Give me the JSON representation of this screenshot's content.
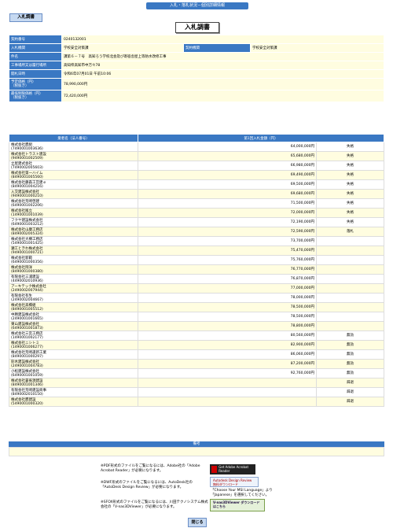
{
  "header": {
    "top_title": "入札・落札状況－個別詳細情報",
    "tag": "入札調書",
    "page_title": "入札調書"
  },
  "info": [
    {
      "label": "契約番号",
      "value": "0240132001"
    },
    {
      "label": "入札機関",
      "value": "学校安全対策課",
      "label2": "契約機関",
      "value2": "学校安全対策課"
    },
    {
      "label": "件名",
      "value": "課第６－７号　高知ろう学校北会及び寄宿舎屋上等防水改修工事"
    },
    {
      "label": "工事場所又は履行場所",
      "value": "高知県高知市中万々78"
    },
    {
      "label": "開札日時",
      "value": "令和6年07月01日 午前10:06"
    },
    {
      "label": "予定価格（円）\n（税抜き）",
      "value": "78,990,000円"
    },
    {
      "label": "最低制限価格（円）\n（税抜き）",
      "value": "72,420,000円"
    }
  ],
  "bids_header": {
    "name": "業者名（法人番号）",
    "amount": "第1回入札金額（円）"
  },
  "bids": [
    {
      "name": "株式会社鷹組",
      "id": "(7490001003636)",
      "amount": "64,000,000円",
      "result": "失格"
    },
    {
      "name": "株式会社トラスト建設",
      "id": "(9490001002509)",
      "amount": "65,680,000円",
      "result": "失格"
    },
    {
      "name": "立屋建式会社",
      "id": "(7490002005603)",
      "amount": "66,980,000円",
      "result": "失格"
    },
    {
      "name": "株式会社第一ハイム",
      "id": "(8490001005560)",
      "amount": "69,490,000円",
      "result": "失格"
    },
    {
      "name": "株式会社藤森工営建ｅ",
      "id": "(8490001004216)",
      "amount": "69,500,000円",
      "result": "失格"
    },
    {
      "name": "入交建設株式会社",
      "id": "(9490001000210)",
      "amount": "69,680,000円",
      "result": "失格"
    },
    {
      "name": "株式会社荒崎啓建",
      "id": "(6490001002206)",
      "amount": "71,500,000円",
      "result": "失格"
    },
    {
      "name": "株式会社尾立",
      "id": "(1490001001039)",
      "amount": "72,000,000円",
      "result": "失格"
    },
    {
      "name": "フクヤ建設株式会社",
      "id": "(6490001003212)",
      "amount": "72,190,000円",
      "result": "失格"
    },
    {
      "name": "株式会社山康工務店",
      "id": "(8490002005324)",
      "amount": "72,590,000円",
      "result": "落札"
    },
    {
      "name": "株式会社大樽工務店",
      "id": "(5490001001425)",
      "amount": "73,700,000円",
      "result": ""
    },
    {
      "name": "瀬工ときわ株式会社",
      "id": "(9490001000721)",
      "amount": "75,470,000円",
      "result": ""
    },
    {
      "name": "株式会社新範",
      "id": "(6490001000356)",
      "amount": "75,760,000円",
      "result": ""
    },
    {
      "name": "株式会社岡洋",
      "id": "(8490001000380)",
      "amount": "76,770,000円",
      "result": ""
    },
    {
      "name": "有限会社三浦建設",
      "id": "(4490002010936)",
      "amount": "76,870,000円",
      "result": ""
    },
    {
      "name": "アーキテック株式会社",
      "id": "(2490002007944)",
      "amount": "77,000,000円",
      "result": ""
    },
    {
      "name": "有限会社有生",
      "id": "(2490002004667)",
      "amount": "78,000,000円",
      "result": ""
    },
    {
      "name": "株式会社高橋組",
      "id": "(8490001005512)",
      "amount": "78,500,000円",
      "result": ""
    },
    {
      "name": "中勝建設株式会社",
      "id": "(2490001001665)",
      "amount": "78,500,000円",
      "result": ""
    },
    {
      "name": "東山建設株式会社",
      "id": "(6490001001873)",
      "amount": "78,800,000円",
      "result": ""
    },
    {
      "name": "株式会社三宮工務店",
      "id": "(1490001002177)",
      "amount": "80,560,000円",
      "result": "無効"
    },
    {
      "name": "株式会社ニシトミ",
      "id": "(1490001006277)",
      "amount": "82,900,000円",
      "result": "無効"
    },
    {
      "name": "株式会社荒崎逢新工業",
      "id": "(8490001000297)",
      "amount": "86,060,000円",
      "result": "無効"
    },
    {
      "name": "鈴木建設株式会社",
      "id": "(2490001004783)",
      "amount": "87,200,000円",
      "result": "無効"
    },
    {
      "name": "小松建設株式会社",
      "id": "(6490001001059)",
      "amount": "92,760,000円",
      "result": "無効"
    },
    {
      "name": "株式会社蒼雀源建設",
      "id": "(8490001001346)",
      "amount": "",
      "result": "辞退"
    },
    {
      "name": "有限会社荒崎建設商事",
      "id": "(8490002010150)",
      "amount": "",
      "result": "辞退"
    },
    {
      "name": "株式会社鷹建設",
      "id": "(5490001000320)",
      "amount": "",
      "result": "辞退"
    }
  ],
  "remarks": {
    "label": "備考",
    "value": ""
  },
  "help": [
    {
      "text": "※PDF形式のファイルをご覧になるには、Adobe社の「Adobe Acrobat Reader」が必要になります。",
      "badge": "Get Adobe Acrobat Reader"
    },
    {
      "text": "※DWF形式のファイルをご覧になるには、AutoDesk社の「AutoDesk Design Review」が必要になります。",
      "badge": "Autodesk Design Review 無料ダウンロード",
      "extra": "「Choose Your MSI Language」より「Japanese」を選択してください。"
    },
    {
      "text": "※SFOX形式のファイルをご覧になるには、川田テクノシステム株式会社の「V-nas3DViewer」が必要になります。",
      "badge": "V-nas3DViewer ダウンロードはこちら"
    }
  ],
  "close_label": "閉じる",
  "colors": {
    "header_blue": "#3a78c3",
    "value_cream": "#fffde0",
    "button_blue": "#c6d9f1"
  }
}
